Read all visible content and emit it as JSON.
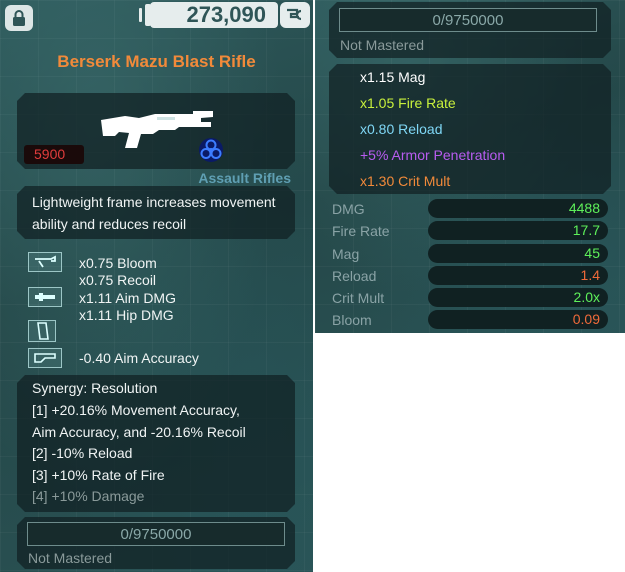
{
  "currency": {
    "amount": "273,090"
  },
  "item": {
    "name": "Berserk Mazu Blast Rifle",
    "power": "5900",
    "category": "Assault Rifles",
    "description": "Lightweight frame increases movement ability and reduces recoil"
  },
  "mods": [
    {
      "icon": "scope-attachment-icon",
      "lines": [
        "x0.75 Bloom",
        "x0.75 Recoil"
      ]
    },
    {
      "icon": "barrel-attachment-icon",
      "lines": [
        "x1.11 Aim DMG",
        "x1.11 Hip DMG"
      ]
    },
    {
      "icon": "magazine-attachment-icon",
      "lines": []
    },
    {
      "icon": "stock-attachment-icon",
      "lines": [
        "-0.40 Aim Accuracy"
      ]
    }
  ],
  "synergy": {
    "title": "Synergy: Resolution",
    "lines": [
      "[1] +20.16% Movement Accuracy,",
      "Aim Accuracy, and -20.16% Recoil",
      "[2] -10% Reload",
      "[3] +10% Rate of Fire",
      "[4] +10% Damage"
    ]
  },
  "mastery": {
    "progress": "0/9750000",
    "status": "Not Mastered"
  },
  "roll_mods": [
    {
      "text": "x1.15 Mag",
      "color": "#ffffff"
    },
    {
      "text": "x1.05 Fire Rate",
      "color": "#c8f03c"
    },
    {
      "text": "x0.80 Reload",
      "color": "#7fd7f5"
    },
    {
      "text": "+5% Armor Penetration",
      "color": "#b85cf0"
    },
    {
      "text": "x1.30 Crit Mult",
      "color": "#f28a3a"
    }
  ],
  "stats": [
    {
      "label": "DMG",
      "value": "4488",
      "color": "#5ef05a"
    },
    {
      "label": "Fire Rate",
      "value": "17.7",
      "color": "#5ef05a"
    },
    {
      "label": "Mag",
      "value": "45",
      "color": "#5ef05a"
    },
    {
      "label": "Reload",
      "value": "1.4",
      "color": "#f06a3a"
    },
    {
      "label": "Crit Mult",
      "value": "2.0x",
      "color": "#5ef05a"
    },
    {
      "label": "Bloom",
      "value": "0.09",
      "color": "#f06a3a"
    }
  ]
}
